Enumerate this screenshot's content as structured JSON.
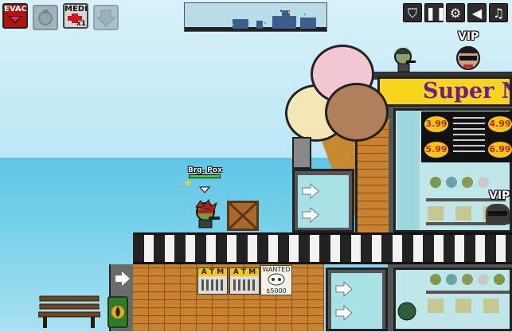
{
  "hud": {
    "evac_label": "EVAC",
    "medi_label": "MEDI",
    "medi_count": "x1"
  },
  "player": {
    "name": "Brg. Pox"
  },
  "npc": {
    "vip_label_top": "VIP",
    "vip_label_side": "VIP"
  },
  "store": {
    "sign_text": "Super N",
    "prices": [
      "3.99",
      "4.99",
      "5.99",
      "6.99"
    ]
  },
  "atm": {
    "label_1": "A T M",
    "label_2": "A T M"
  },
  "poster": {
    "title": "WANTED",
    "reward": "$5000"
  },
  "colors": {
    "sky": "#bfe8f6",
    "sea": "#74cfe9",
    "sign": "#f7d51c",
    "sign_text": "#6b1f8f",
    "evac": "#b81010",
    "hp": "#3bd336"
  }
}
